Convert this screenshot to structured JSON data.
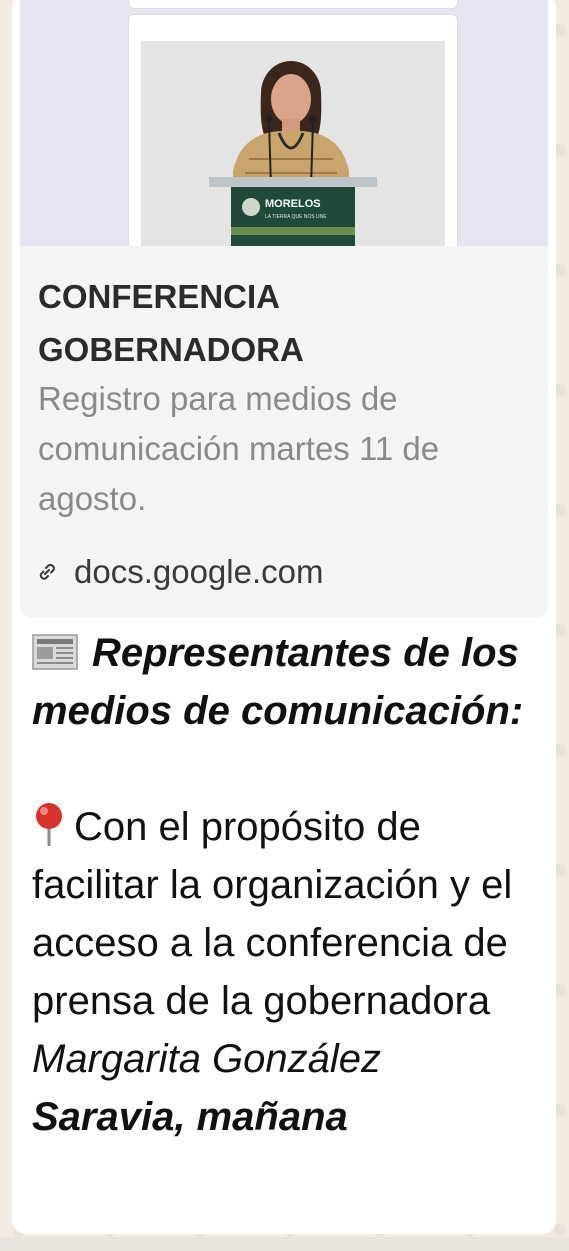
{
  "link_preview": {
    "title": "CONFERENCIA\nGOBERNADORA",
    "description": "Registro para medios de comunicación martes 11 de agosto.",
    "domain": "docs.google.com",
    "image": {
      "podium_logo_text": "MORELOS",
      "podium_logo_subtext": "LA TIERRA QUE NOS UNE"
    }
  },
  "message": {
    "heading": "Representantes de los medios de comunicación:",
    "body_intro": "Con el propósito de facilitar la organización y el acceso a la conferencia de prensa de la gobernadora ",
    "body_name": "Margarita González",
    "body_cut": "Saravia, mañana"
  },
  "icons": {
    "heading_icon": "newspaper-icon",
    "body_icon": "round-pushpin-icon",
    "link_icon": "link-icon"
  },
  "colors": {
    "bubble": "#ffffff",
    "preview_background": "#f4f4f4",
    "description_text": "#8a8a8a",
    "podium_green": "#1f4a3a",
    "pin_red": "#d9312b"
  }
}
